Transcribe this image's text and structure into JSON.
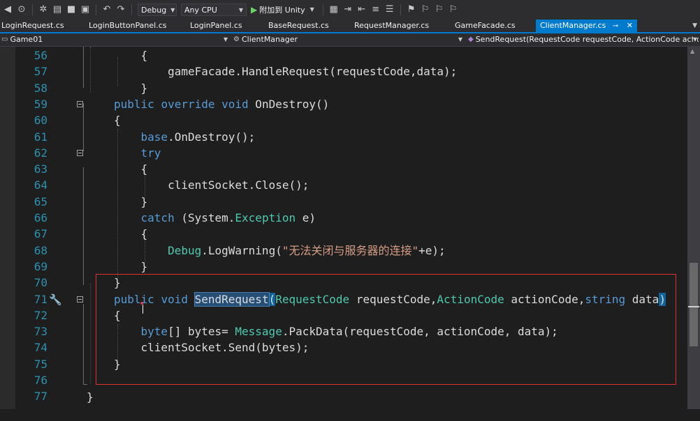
{
  "toolbar": {
    "config": "Debug",
    "platform": "Any CPU",
    "run_label": "附加到 Unity"
  },
  "tabs": [
    {
      "label": "LoginRequest.cs"
    },
    {
      "label": "LoginButtonPanel.cs"
    },
    {
      "label": "LoginPanel.cs"
    },
    {
      "label": "BaseRequest.cs"
    },
    {
      "label": "RequestManager.cs"
    },
    {
      "label": "GameFacade.cs"
    },
    {
      "label": "ClientManager.cs",
      "active": true
    }
  ],
  "nav": {
    "project": "Game01",
    "class": "ClientManager",
    "member": "SendRequest(RequestCode requestCode, ActionCode action"
  },
  "lines": [
    {
      "num": "56",
      "tokens": [
        {
          "t": "    {",
          "c": ""
        }
      ]
    },
    {
      "num": "57",
      "tokens": [
        {
          "t": "        gameFacade.HandleRequest(requestCode,data);",
          "c": ""
        }
      ]
    },
    {
      "num": "58",
      "tokens": [
        {
          "t": "    }",
          "c": ""
        }
      ]
    },
    {
      "num": "59",
      "tokens": [
        {
          "t": "public",
          "c": "kw"
        },
        {
          "t": " ",
          "c": ""
        },
        {
          "t": "override",
          "c": "kw"
        },
        {
          "t": " ",
          "c": ""
        },
        {
          "t": "void",
          "c": "kw"
        },
        {
          "t": " OnDestroy()",
          "c": ""
        }
      ]
    },
    {
      "num": "60",
      "tokens": [
        {
          "t": "{",
          "c": ""
        }
      ]
    },
    {
      "num": "61",
      "tokens": [
        {
          "t": "    ",
          "c": ""
        },
        {
          "t": "base",
          "c": "kw"
        },
        {
          "t": ".OnDestroy();",
          "c": ""
        }
      ]
    },
    {
      "num": "62",
      "tokens": [
        {
          "t": "    ",
          "c": ""
        },
        {
          "t": "try",
          "c": "kw"
        }
      ]
    },
    {
      "num": "63",
      "tokens": [
        {
          "t": "    {",
          "c": ""
        }
      ]
    },
    {
      "num": "64",
      "tokens": [
        {
          "t": "        clientSocket.Close();",
          "c": ""
        }
      ]
    },
    {
      "num": "65",
      "tokens": [
        {
          "t": "    }",
          "c": ""
        }
      ]
    },
    {
      "num": "66",
      "tokens": [
        {
          "t": "    ",
          "c": ""
        },
        {
          "t": "catch",
          "c": "kw"
        },
        {
          "t": " (System.",
          "c": ""
        },
        {
          "t": "Exception",
          "c": "ty"
        },
        {
          "t": " e)",
          "c": ""
        }
      ]
    },
    {
      "num": "67",
      "tokens": [
        {
          "t": "    {",
          "c": ""
        }
      ]
    },
    {
      "num": "68",
      "tokens": [
        {
          "t": "        ",
          "c": ""
        },
        {
          "t": "Debug",
          "c": "ty"
        },
        {
          "t": ".LogWarning(",
          "c": ""
        },
        {
          "t": "\"无法关闭与服务器的连接\"",
          "c": "st"
        },
        {
          "t": "+e);",
          "c": ""
        }
      ]
    },
    {
      "num": "69",
      "tokens": [
        {
          "t": "    }",
          "c": ""
        }
      ]
    },
    {
      "num": "70",
      "tokens": [
        {
          "t": "}",
          "c": ""
        }
      ]
    },
    {
      "num": "71",
      "tokens": [
        {
          "t": "public",
          "c": "kw"
        },
        {
          "t": " ",
          "c": ""
        },
        {
          "t": "void",
          "c": "kw"
        },
        {
          "t": " ",
          "c": ""
        },
        {
          "t": "SendRequest",
          "c": "hl"
        },
        {
          "t": "(",
          "c": "br-hl"
        },
        {
          "t": "RequestCode",
          "c": "ty"
        },
        {
          "t": " requestCode,",
          "c": ""
        },
        {
          "t": "ActionCode",
          "c": "ty"
        },
        {
          "t": " actionCode,",
          "c": ""
        },
        {
          "t": "string",
          "c": "kw"
        },
        {
          "t": " data",
          "c": ""
        },
        {
          "t": ")",
          "c": "br-hl"
        }
      ]
    },
    {
      "num": "72",
      "tokens": [
        {
          "t": "{",
          "c": ""
        }
      ]
    },
    {
      "num": "73",
      "tokens": [
        {
          "t": "    ",
          "c": ""
        },
        {
          "t": "byte",
          "c": "kw"
        },
        {
          "t": "[] bytes= ",
          "c": ""
        },
        {
          "t": "Message",
          "c": "ty"
        },
        {
          "t": ".PackData(requestCode, actionCode, data);",
          "c": ""
        }
      ]
    },
    {
      "num": "74",
      "tokens": [
        {
          "t": "    clientSocket.Send(bytes);",
          "c": ""
        }
      ]
    },
    {
      "num": "75",
      "tokens": [
        {
          "t": "}",
          "c": ""
        }
      ]
    },
    {
      "num": "76",
      "tokens": [
        {
          "t": "",
          "c": ""
        }
      ]
    },
    {
      "num": "77",
      "tokens": [
        {
          "t": "",
          "c": ""
        }
      ]
    }
  ],
  "closing_brace_76": "}"
}
